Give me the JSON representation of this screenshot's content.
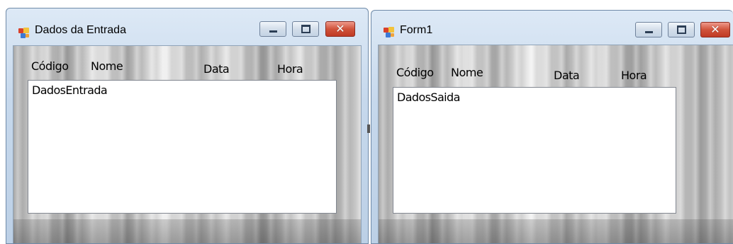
{
  "windows": {
    "entrada": {
      "title": "Dados da Entrada",
      "columns": {
        "codigo": "Código",
        "nome": "Nome",
        "data": "Data",
        "hora": "Hora"
      },
      "list_items": [
        "DadosEntrada"
      ]
    },
    "saida": {
      "title": "Form1",
      "columns": {
        "codigo": "Código",
        "nome": "Nome",
        "data": "Data",
        "hora": "Hora"
      },
      "list_items": [
        "DadosSaida"
      ]
    }
  },
  "icons": {
    "app": "windows-form-icon",
    "minimize": "minimize-icon",
    "maximize": "maximize-icon",
    "close": "close-icon"
  },
  "colors": {
    "title_bar": "#c6d8ec",
    "close_button": "#d0533b",
    "list_background": "#ffffff"
  }
}
